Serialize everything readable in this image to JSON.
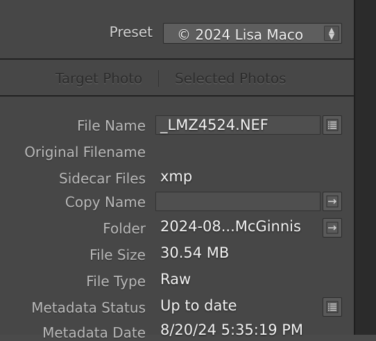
{
  "preset": {
    "label": "Preset",
    "value": "© 2024 Lisa Maco"
  },
  "tabs": [
    "Target Photo",
    "Selected Photos"
  ],
  "rows": {
    "file_name": {
      "label": "File Name",
      "value": "_LMZ4524.NEF"
    },
    "original_filename": {
      "label": "Original Filename",
      "value": ""
    },
    "sidecar_files": {
      "label": "Sidecar Files",
      "value": "xmp"
    },
    "copy_name": {
      "label": "Copy Name",
      "value": ""
    },
    "folder": {
      "label": "Folder",
      "value": "2024-08...McGinnis"
    },
    "file_size": {
      "label": "File Size",
      "value": "30.54 MB"
    },
    "file_type": {
      "label": "File Type",
      "value": "Raw"
    },
    "metadata_status": {
      "label": "Metadata Status",
      "value": "Up to date"
    },
    "metadata_date": {
      "label": "Metadata Date",
      "value": "8/20/24 5:35:19 PM"
    }
  },
  "icons": {
    "list_button": "list-icon",
    "go_button": "arrow-right-icon",
    "select_arrows": "updown-arrows-icon"
  },
  "colors": {
    "panel_bg": "#474747",
    "text_light": "#f2f2f2",
    "label": "#b9b9b9"
  }
}
